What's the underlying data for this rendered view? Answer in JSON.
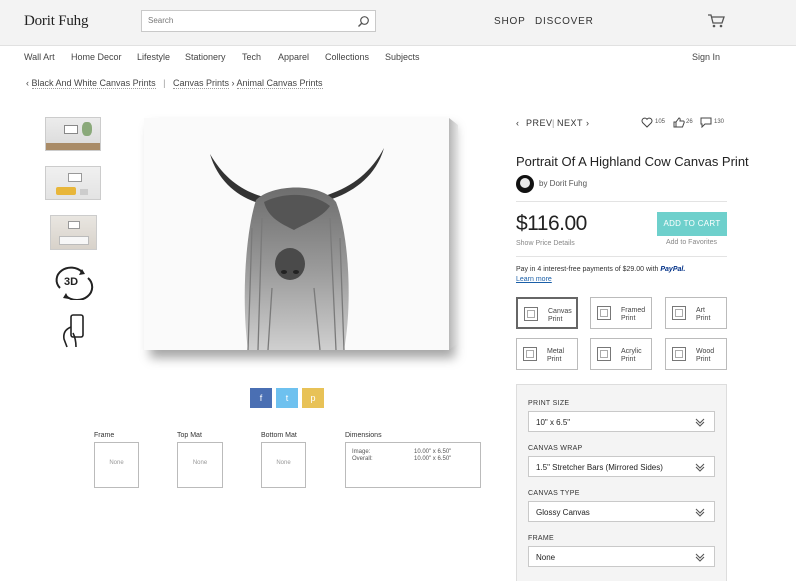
{
  "header": {
    "logo": "Dorit Fuhg",
    "search_placeholder": "Search",
    "nav": [
      "SHOP",
      "DISCOVER"
    ]
  },
  "categories": [
    "Wall Art",
    "Home Decor",
    "Lifestyle",
    "Stationery",
    "Tech",
    "Apparel",
    "Collections",
    "Subjects"
  ],
  "sign_in": "Sign In",
  "breadcrumbs": [
    "Black And White Canvas Prints",
    "Canvas Prints",
    "Animal Canvas Prints"
  ],
  "thumb_3d": "3D",
  "share": [
    "f",
    "t",
    "p"
  ],
  "options": {
    "frame_label": "Frame",
    "frame_value": "None",
    "top_mat_label": "Top Mat",
    "top_mat_value": "None",
    "bottom_mat_label": "Bottom Mat",
    "bottom_mat_value": "None",
    "dimensions_label": "Dimensions",
    "image_label": "Image:",
    "image_value": "10.00\" x 6.50\"",
    "overall_label": "Overall:",
    "overall_value": "10.00\" x 6.50\""
  },
  "pager": {
    "prev": "PREV",
    "separator": "|",
    "next": "NEXT"
  },
  "social": {
    "likes": "105",
    "thumbs": "26",
    "comments": "130"
  },
  "product": {
    "title": "Portrait Of A Highland Cow Canvas Print",
    "artist": "by Dorit Fuhg",
    "price": "$116.00",
    "price_details": "Show Price Details",
    "add_to_cart": "ADD TO CART",
    "add_to_favorites": "Add to Favorites",
    "paypal_text": "Pay in 4 interest-free payments of $29.00 with",
    "paypal_brand": "PayPal.",
    "learn_more": "Learn more"
  },
  "print_types": [
    {
      "line1": "Canvas",
      "line2": "Print",
      "selected": true
    },
    {
      "line1": "Framed",
      "line2": "Print",
      "selected": false
    },
    {
      "line1": "Art",
      "line2": "Print",
      "selected": false
    },
    {
      "line1": "Metal",
      "line2": "Print",
      "selected": false
    },
    {
      "line1": "Acrylic",
      "line2": "Print",
      "selected": false
    },
    {
      "line1": "Wood",
      "line2": "Print",
      "selected": false
    }
  ],
  "selectors": [
    {
      "label": "PRINT SIZE",
      "value": "10\" x 6.5\""
    },
    {
      "label": "CANVAS WRAP",
      "value": "1.5\" Stretcher Bars (Mirrored Sides)"
    },
    {
      "label": "CANVAS TYPE",
      "value": "Glossy Canvas"
    },
    {
      "label": "FRAME",
      "value": "None"
    }
  ],
  "colors": {
    "accent": "#6ed0cc",
    "facebook": "#4a6fb3",
    "twitter": "#6ec1ef",
    "pinterest": "#e8c257",
    "paypal": "#003087"
  }
}
